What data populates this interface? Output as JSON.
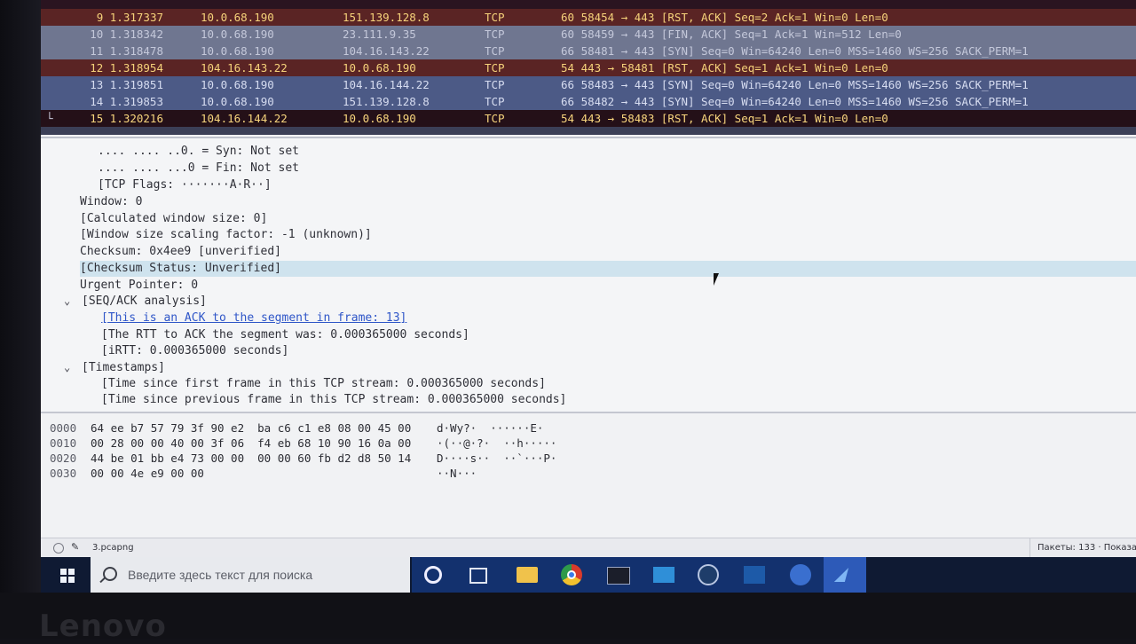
{
  "packet_list": {
    "rows": [
      {
        "no": "9 1.317337",
        "src": "10.0.68.190",
        "dst": "151.139.128.8",
        "proto": "TCP",
        "info": "60 58454 → 443 [RST, ACK] Seq=2 Ack=1 Win=0 Len=0",
        "style": "rst"
      },
      {
        "no": "10 1.318342",
        "src": "10.0.68.190",
        "dst": "23.111.9.35",
        "proto": "TCP",
        "info": "60 58459 → 443 [FIN, ACK] Seq=1 Ack=1 Win=512 Len=0",
        "style": "grey"
      },
      {
        "no": "11 1.318478",
        "src": "10.0.68.190",
        "dst": "104.16.143.22",
        "proto": "TCP",
        "info": "66 58481 → 443 [SYN] Seq=0 Win=64240 Len=0 MSS=1460 WS=256 SACK_PERM=1",
        "style": "grey"
      },
      {
        "no": "12 1.318954",
        "src": "104.16.143.22",
        "dst": "10.0.68.190",
        "proto": "TCP",
        "info": "54 443 → 58481 [RST, ACK] Seq=1 Ack=1 Win=0 Len=0",
        "style": "rst"
      },
      {
        "no": "13 1.319851",
        "src": "10.0.68.190",
        "dst": "104.16.144.22",
        "proto": "TCP",
        "info": "66 58483 → 443 [SYN] Seq=0 Win=64240 Len=0 MSS=1460 WS=256 SACK_PERM=1",
        "style": "blue"
      },
      {
        "no": "14 1.319853",
        "src": "10.0.68.190",
        "dst": "151.139.128.8",
        "proto": "TCP",
        "info": "66 58482 → 443 [SYN] Seq=0 Win=64240 Len=0 MSS=1460 WS=256 SACK_PERM=1",
        "style": "blue"
      },
      {
        "no": "15 1.320216",
        "src": "104.16.144.22",
        "dst": "10.0.68.190",
        "proto": "TCP",
        "info": "54 443 → 58483 [RST, ACK] Seq=1 Ack=1 Win=0 Len=0",
        "style": "sel"
      }
    ]
  },
  "details": {
    "syn": ".... .... ..0. = Syn: Not set",
    "fin": ".... .... ...0 = Fin: Not set",
    "tcp_flags": "[TCP Flags: ·······A·R··]",
    "window": "Window: 0",
    "calc_window": "[Calculated window size: 0]",
    "scaling": "[Window size scaling factor: -1 (unknown)]",
    "checksum": "Checksum: 0x4ee9 [unverified]",
    "checksum_status": "[Checksum Status: Unverified]",
    "urgent": "Urgent Pointer: 0",
    "seq_ack": "[SEQ/ACK analysis]",
    "ack_link": "[This is an ACK to the segment in frame: 13]",
    "rtt": "[The RTT to ACK the segment was: 0.000365000 seconds]",
    "irtt": "[iRTT: 0.000365000 seconds]",
    "timestamps": "[Timestamps]",
    "since_first": "[Time since first frame in this TCP stream: 0.000365000 seconds]",
    "since_prev": "[Time since previous frame in this TCP stream: 0.000365000 seconds]"
  },
  "bytes": {
    "lines": [
      {
        "offset": "0000",
        "hex": "64 ee b7 57 79 3f 90 e2  ba c6 c1 e8 08 00 45 00",
        "ascii": "d·Wy?·  ······E·"
      },
      {
        "offset": "0010",
        "hex": "00 28 00 00 40 00 3f 06  f4 eb 68 10 90 16 0a 00",
        "ascii": "·(··@·?·  ··h·····"
      },
      {
        "offset": "0020",
        "hex": "44 be 01 bb e4 73 00 00  00 00 60 fb d2 d8 50 14",
        "ascii": "D····s··  ··`···P·"
      },
      {
        "offset": "0030",
        "hex": "00 00 4e e9 00 00",
        "ascii": "··N···"
      }
    ]
  },
  "status": {
    "file": "3.pcapng",
    "right": "Пакеты: 133 · Показаны"
  },
  "taskbar": {
    "search_placeholder": "Введите здесь текст для поиска"
  },
  "brand": "Lenovo"
}
